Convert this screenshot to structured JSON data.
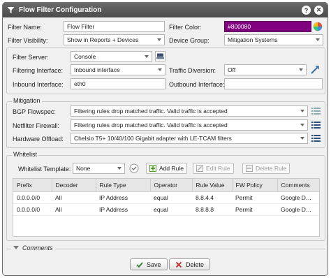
{
  "window": {
    "title": "Flow Filter Configuration",
    "help_icon": "?",
    "close_icon": "✕"
  },
  "top": {
    "filter_name_label": "Filter Name:",
    "filter_name_value": "Flow Filter",
    "filter_color_label": "Filter Color:",
    "filter_color_value": "#800080",
    "filter_visibility_label": "Filter Visibility:",
    "filter_visibility_value": "Show in Reports + Devices",
    "device_group_label": "Device Group:",
    "device_group_value": "Mitigation Systems"
  },
  "server": {
    "filter_server_label": "Filter Server:",
    "filter_server_value": "Console",
    "filtering_interface_label": "Filtering Interface:",
    "filtering_interface_value": "Inbound interface",
    "traffic_diversion_label": "Traffic Diversion:",
    "traffic_diversion_value": "Off",
    "inbound_interface_label": "Inbound Interface:",
    "inbound_interface_value": "eth0",
    "outbound_interface_label": "Outbound Interface:",
    "outbound_interface_value": ""
  },
  "mitigation": {
    "legend": "Mitigation",
    "bgp_label": "BGP Flowspec:",
    "bgp_value": "Filtering rules drop matched traffic. Valid traffic is accepted",
    "netfilter_label": "Netfilter Firewall:",
    "netfilter_value": "Filtering rules drop matched traffic. Valid traffic is accepted",
    "hw_label": "Hardware Offload:",
    "hw_value": "Chelsio T5+ 10/40/100 Gigabit adapter with LE-TCAM filters"
  },
  "whitelist": {
    "legend": "Whitelist",
    "template_label": "Whitelist Template:",
    "template_value": "None",
    "add_rule": "Add Rule",
    "edit_rule": "Edit Rule",
    "delete_rule": "Delete Rule",
    "columns": [
      "Prefix",
      "Decoder",
      "Rule Type",
      "Operator",
      "Rule Value",
      "FW Policy",
      "Comments"
    ],
    "rows": [
      [
        "0.0.0.0/0",
        "All",
        "IP Address",
        "equal",
        "8.8.4.4",
        "Permit",
        "Google D…"
      ],
      [
        "0.0.0.0/0",
        "All",
        "IP Address",
        "equal",
        "8.8.8.8",
        "Permit",
        "Google D…"
      ]
    ]
  },
  "comments": {
    "legend": "Comments"
  },
  "footer": {
    "save": "Save",
    "delete": "Delete"
  },
  "colors": {
    "filter_color": "#800080",
    "titlebar": "#555555"
  }
}
